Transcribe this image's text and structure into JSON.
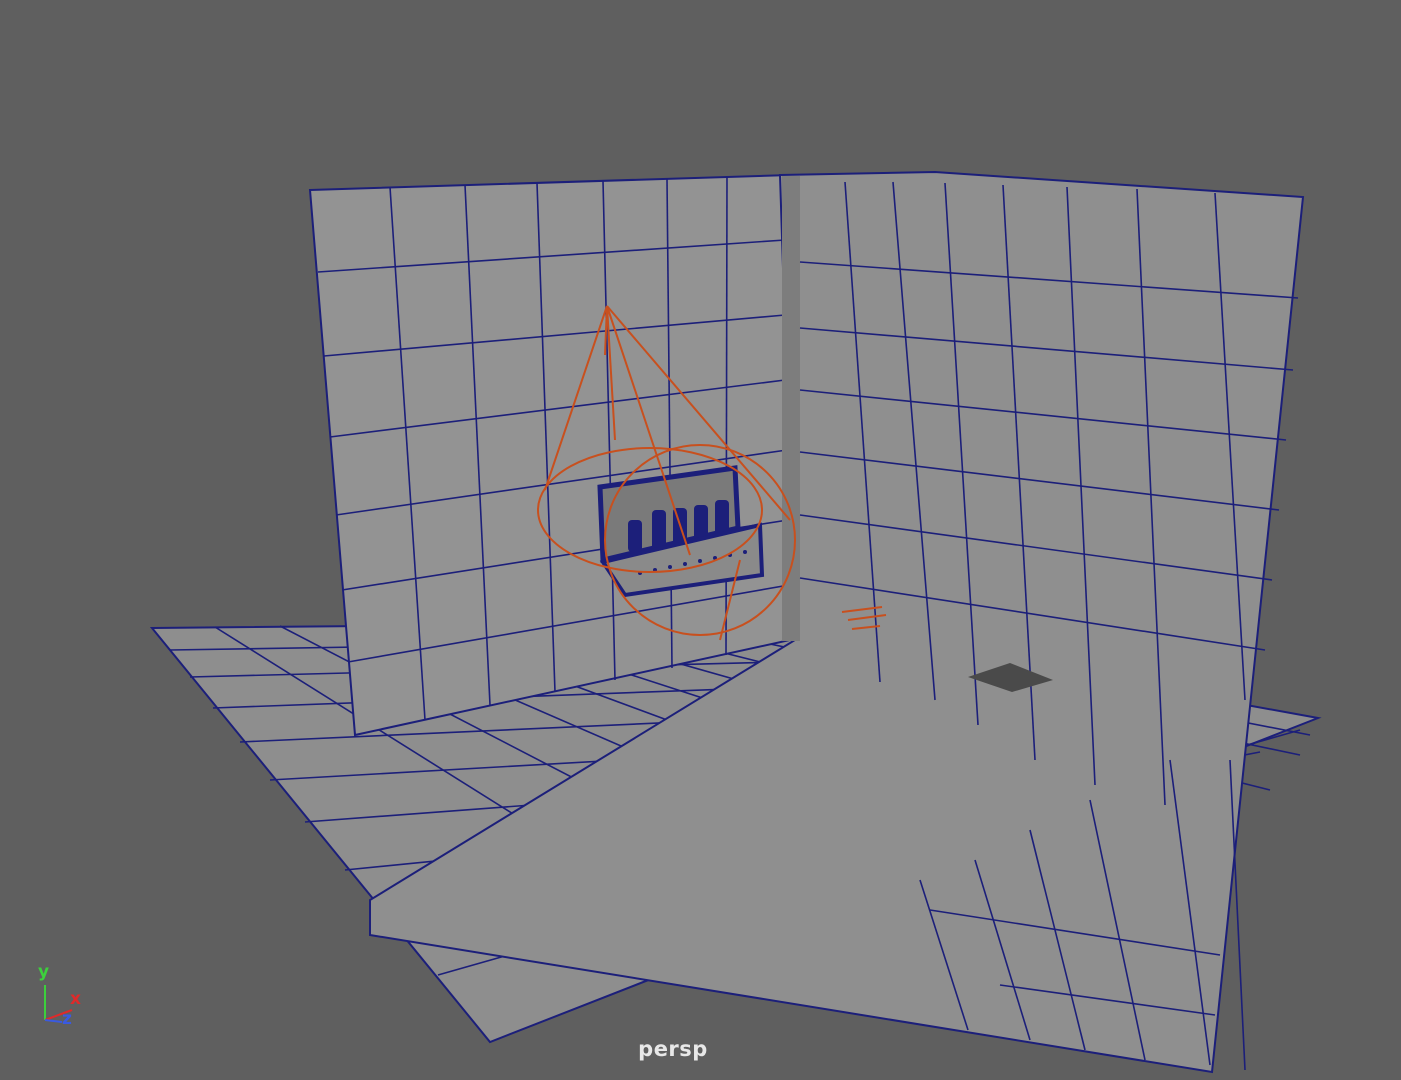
{
  "viewport": {
    "camera_name": "persp",
    "background_color": "#5f5f5f",
    "wireframe_color": "#1c1f7a",
    "selection_color": "#c8501e",
    "plane_fill_color": "#8e8e8e"
  },
  "axis_gizmo": {
    "y_label": "y",
    "x_label": "x",
    "z_label": "z",
    "y_color": "#3cd03c",
    "x_color": "#e02a2a",
    "z_color": "#3a5ae0"
  },
  "scene_objects": [
    {
      "name": "floor-plane",
      "type": "polyPlane"
    },
    {
      "name": "back-wall-plane",
      "type": "polyPlane"
    },
    {
      "name": "side-wall-plane",
      "type": "polyPlane"
    },
    {
      "name": "spot-light",
      "type": "spotLight",
      "selected": true
    },
    {
      "name": "bottle-tray",
      "type": "mesh"
    },
    {
      "name": "directional-light",
      "type": "directionalLight",
      "selected": true
    },
    {
      "name": "area-shadow",
      "type": "mesh"
    }
  ]
}
